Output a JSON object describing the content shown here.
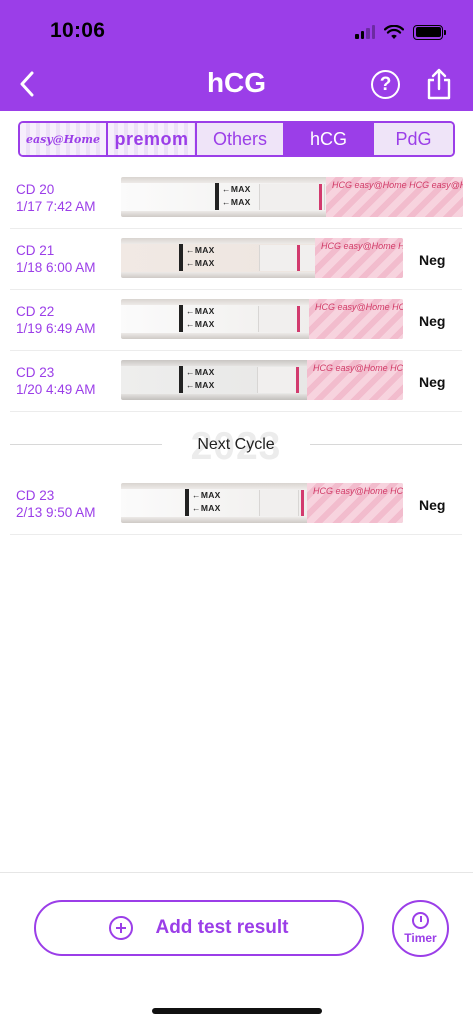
{
  "status_bar": {
    "time": "10:06"
  },
  "nav": {
    "title": "hCG"
  },
  "tabs": [
    {
      "label": "easy@Home",
      "kind": "easy",
      "active": false
    },
    {
      "label": "premom",
      "kind": "premom",
      "active": false
    },
    {
      "label": "Others",
      "kind": "others",
      "active": false
    },
    {
      "label": "hCG",
      "kind": "hcg",
      "active": true
    },
    {
      "label": "PdG",
      "kind": "pdg",
      "active": false
    }
  ],
  "strip_labels": {
    "max": "MAX",
    "arrow": "←",
    "brand_text": "HCG easy@Home HCG easy@Home HCG easy@Home"
  },
  "tests": [
    {
      "cycle_day": "CD 20",
      "datetime": "1/17 7:42 AM",
      "result": ""
    },
    {
      "cycle_day": "CD 21",
      "datetime": "1/18 6:00 AM",
      "result": "Neg"
    },
    {
      "cycle_day": "CD 22",
      "datetime": "1/19 6:49 AM",
      "result": "Neg"
    },
    {
      "cycle_day": "CD 23",
      "datetime": "1/20 4:49 AM",
      "result": "Neg"
    }
  ],
  "cycle_separator": {
    "year": "2023",
    "label": "Next Cycle"
  },
  "tests_next_cycle": [
    {
      "cycle_day": "CD 23",
      "datetime": "2/13 9:50 AM",
      "result": "Neg"
    }
  ],
  "actions": {
    "add_test_result": "Add test result",
    "timer": "Timer"
  },
  "colors": {
    "accent": "#9b3ee8",
    "strip_pink": "#f2bccd",
    "control_line": "#d23a6e"
  }
}
